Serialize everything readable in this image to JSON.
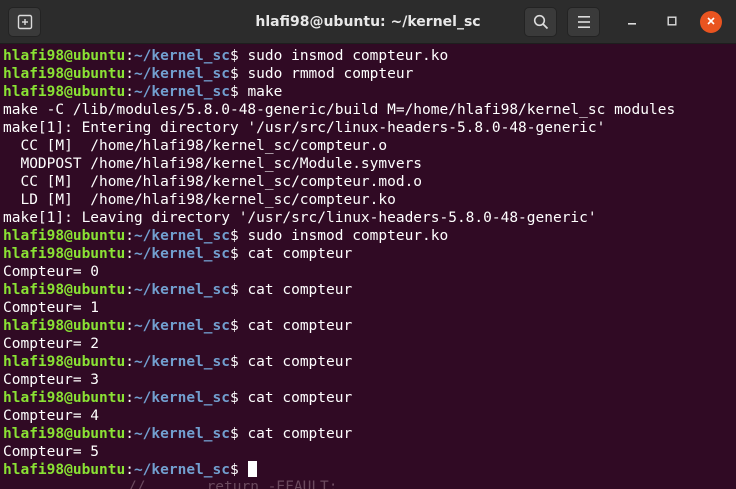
{
  "window": {
    "title": "hlafi98@ubuntu: ~/kernel_sc"
  },
  "titlebar": {
    "new_tab_icon": "new-tab-icon",
    "search_icon": "search-icon",
    "menu_icon": "hamburger-menu-icon",
    "minimize_icon": "minimize-icon",
    "maximize_icon": "maximize-icon",
    "close_icon": "close-icon"
  },
  "colors": {
    "background": "#300a24",
    "prompt_user": "#8ae234",
    "prompt_path": "#729fcf",
    "text": "#ffffff",
    "close_button": "#e95420"
  },
  "prompt": {
    "user": "hlafi98@ubuntu",
    "sep": ":",
    "path": "~/kernel_sc",
    "symbol": "$ "
  },
  "lines": [
    {
      "type": "prompt",
      "cmd": "sudo insmod compteur.ko"
    },
    {
      "type": "prompt",
      "cmd": "sudo rmmod compteur"
    },
    {
      "type": "prompt",
      "cmd": "make"
    },
    {
      "type": "output",
      "text": "make -C /lib/modules/5.8.0-48-generic/build M=/home/hlafi98/kernel_sc modules"
    },
    {
      "type": "output",
      "text": "make[1]: Entering directory '/usr/src/linux-headers-5.8.0-48-generic'"
    },
    {
      "type": "output",
      "text": "  CC [M]  /home/hlafi98/kernel_sc/compteur.o"
    },
    {
      "type": "output",
      "text": "  MODPOST /home/hlafi98/kernel_sc/Module.symvers"
    },
    {
      "type": "output",
      "text": "  CC [M]  /home/hlafi98/kernel_sc/compteur.mod.o"
    },
    {
      "type": "output",
      "text": "  LD [M]  /home/hlafi98/kernel_sc/compteur.ko"
    },
    {
      "type": "output",
      "text": "make[1]: Leaving directory '/usr/src/linux-headers-5.8.0-48-generic'"
    },
    {
      "type": "prompt",
      "cmd": "sudo insmod compteur.ko"
    },
    {
      "type": "prompt",
      "cmd": "cat compteur"
    },
    {
      "type": "output",
      "text": "Compteur= 0"
    },
    {
      "type": "prompt",
      "cmd": "cat compteur"
    },
    {
      "type": "output",
      "text": "Compteur= 1"
    },
    {
      "type": "prompt",
      "cmd": "cat compteur"
    },
    {
      "type": "output",
      "text": "Compteur= 2"
    },
    {
      "type": "prompt",
      "cmd": "cat compteur"
    },
    {
      "type": "output",
      "text": "Compteur= 3"
    },
    {
      "type": "prompt",
      "cmd": "cat compteur"
    },
    {
      "type": "output",
      "text": "Compteur= 4"
    },
    {
      "type": "prompt",
      "cmd": "cat compteur"
    },
    {
      "type": "output",
      "text": "Compteur= 5"
    },
    {
      "type": "prompt",
      "cmd": "",
      "cursor": true
    }
  ],
  "ghost_text": "//       return -EFAULT;"
}
